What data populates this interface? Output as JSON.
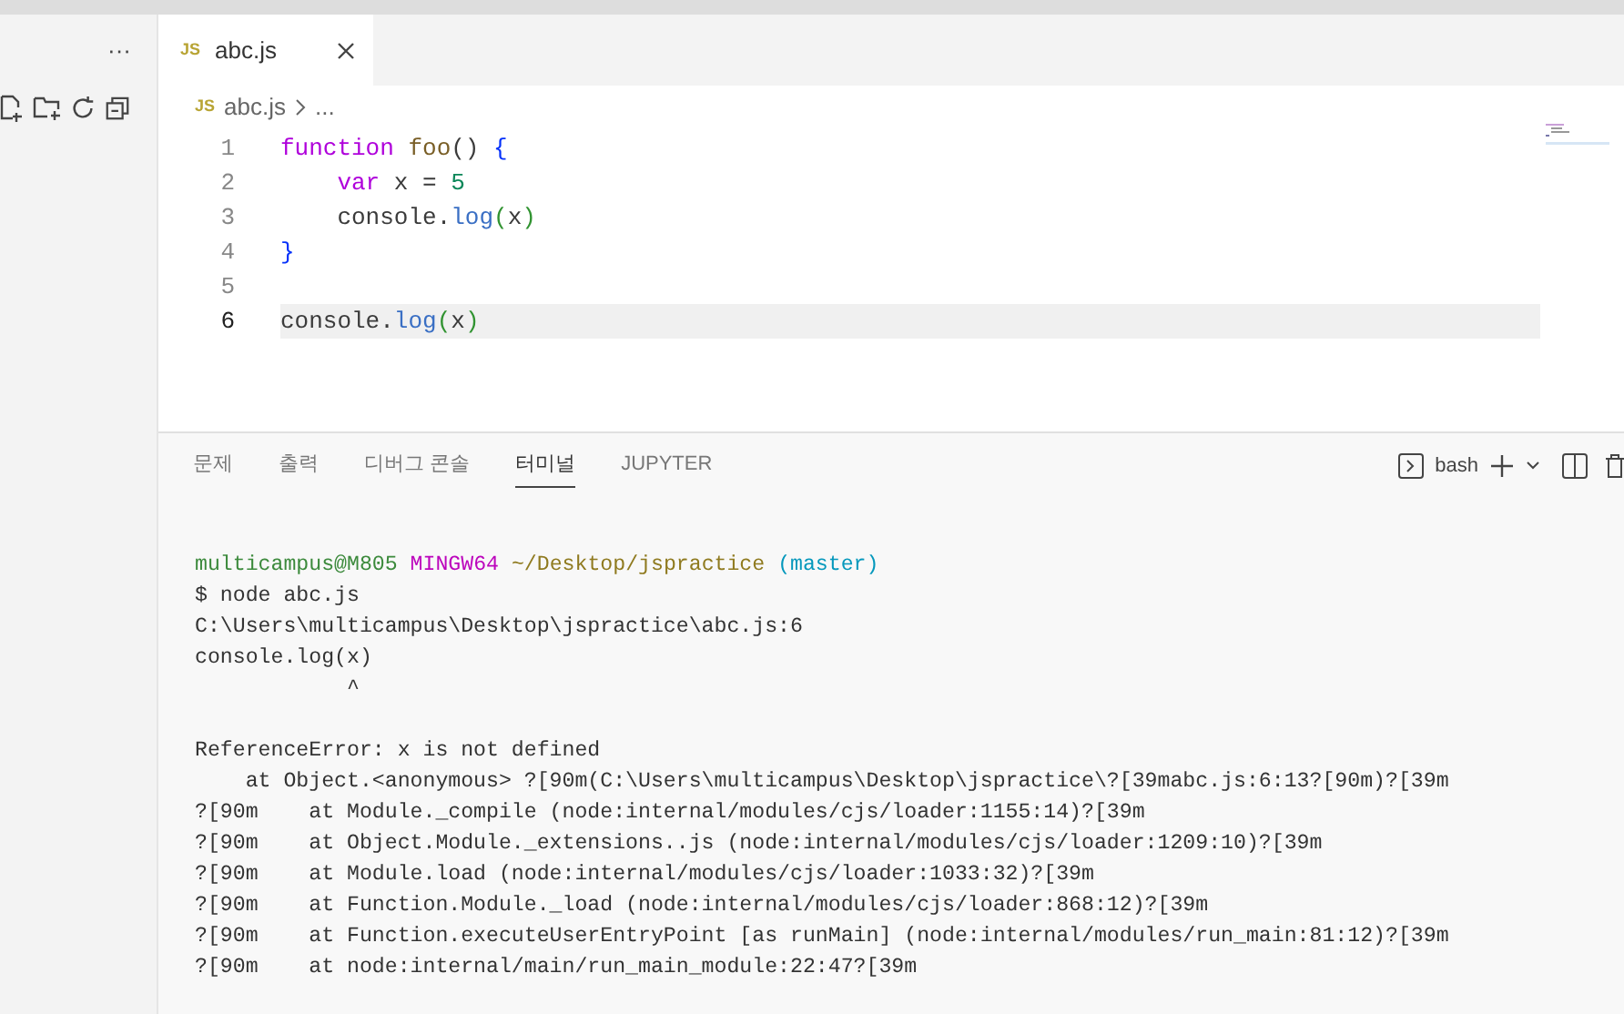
{
  "sidebar": {
    "more": "···"
  },
  "tabs": [
    {
      "label": "abc.js",
      "icon": "JS",
      "selected": true
    }
  ],
  "breadcrumb": {
    "icon": "JS",
    "file": "abc.js",
    "rest": "..."
  },
  "code_lines": [
    {
      "number": "1",
      "current": false,
      "tokens": [
        {
          "kind": "keyword",
          "text": "function "
        },
        {
          "kind": "func",
          "text": "foo"
        },
        {
          "kind": "plain",
          "text": "() "
        },
        {
          "kind": "brace",
          "text": "{"
        }
      ]
    },
    {
      "number": "2",
      "current": false,
      "tokens": [
        {
          "kind": "keyword",
          "text": "    var"
        },
        {
          "kind": "plain",
          "text": " x = "
        },
        {
          "kind": "number",
          "text": "5"
        }
      ]
    },
    {
      "number": "3",
      "current": false,
      "tokens": [
        {
          "kind": "plain",
          "text": "    console."
        },
        {
          "kind": "method",
          "text": "log"
        },
        {
          "kind": "paren",
          "text": "("
        },
        {
          "kind": "plain",
          "text": "x"
        },
        {
          "kind": "paren",
          "text": ")"
        }
      ]
    },
    {
      "number": "4",
      "current": false,
      "tokens": [
        {
          "kind": "brace",
          "text": "}"
        }
      ]
    },
    {
      "number": "5",
      "current": false
    },
    {
      "number": "6",
      "current": true,
      "tokens": [
        {
          "kind": "plain",
          "text": "console."
        },
        {
          "kind": "method",
          "text": "log"
        },
        {
          "kind": "paren",
          "text": "("
        },
        {
          "kind": "plain",
          "text": "x"
        },
        {
          "kind": "paren",
          "text": ")"
        }
      ]
    }
  ],
  "panel_tabs": [
    {
      "label": "문제",
      "selected": false
    },
    {
      "label": "출력",
      "selected": false
    },
    {
      "label": "디버그 콘솔",
      "selected": false
    },
    {
      "label": "터미널",
      "selected": true
    },
    {
      "label": "JUPYTER",
      "selected": false
    }
  ],
  "terminal_toolbar": {
    "shell": "bash"
  },
  "terminal_lines": [
    {
      "gap_before": false,
      "segments": [
        {
          "kind": "user",
          "text": "multicampus@M805 "
        },
        {
          "kind": "host",
          "text": "MINGW64 "
        },
        {
          "kind": "path",
          "text": "~/Desktop/jspractice "
        },
        {
          "kind": "branch",
          "text": "(master)"
        }
      ]
    },
    {
      "gap_before": false,
      "segments": [
        {
          "kind": "plain",
          "text": "$ node abc.js"
        }
      ]
    },
    {
      "gap_before": false,
      "segments": [
        {
          "kind": "plain",
          "text": "C:\\Users\\multicampus\\Desktop\\jspractice\\abc.js:6"
        }
      ]
    },
    {
      "gap_before": false,
      "segments": [
        {
          "kind": "plain",
          "text": "console.log(x)"
        }
      ]
    },
    {
      "gap_before": false,
      "segments": [
        {
          "kind": "plain",
          "text": "            ^"
        }
      ]
    },
    {
      "gap_before": true,
      "segments": [
        {
          "kind": "plain",
          "text": "ReferenceError: x is not defined"
        }
      ]
    },
    {
      "gap_before": false,
      "segments": [
        {
          "kind": "plain",
          "text": "    at Object.<anonymous> ?[90m(C:\\Users\\multicampus\\Desktop\\jspractice\\?[39mabc.js:6:13?[90m)?[39m"
        }
      ]
    },
    {
      "gap_before": false,
      "segments": [
        {
          "kind": "plain",
          "text": "?[90m    at Module._compile (node:internal/modules/cjs/loader:1155:14)?[39m"
        }
      ]
    },
    {
      "gap_before": false,
      "segments": [
        {
          "kind": "plain",
          "text": "?[90m    at Object.Module._extensions..js (node:internal/modules/cjs/loader:1209:10)?[39m"
        }
      ]
    },
    {
      "gap_before": false,
      "segments": [
        {
          "kind": "plain",
          "text": "?[90m    at Module.load (node:internal/modules/cjs/loader:1033:32)?[39m"
        }
      ]
    },
    {
      "gap_before": false,
      "segments": [
        {
          "kind": "plain",
          "text": "?[90m    at Function.Module._load (node:internal/modules/cjs/loader:868:12)?[39m"
        }
      ]
    },
    {
      "gap_before": false,
      "segments": [
        {
          "kind": "plain",
          "text": "?[90m    at Function.executeUserEntryPoint [as runMain] (node:internal/modules/run_main:81:12)?[39m"
        }
      ]
    },
    {
      "gap_before": false,
      "segments": [
        {
          "kind": "plain",
          "text": "?[90m    at node:internal/main/run_main_module:22:47?[39m"
        }
      ]
    }
  ]
}
